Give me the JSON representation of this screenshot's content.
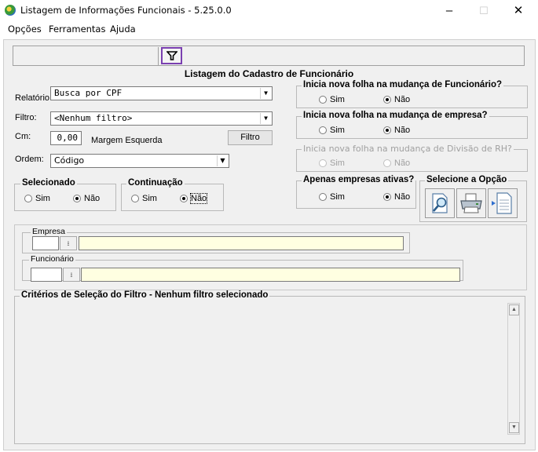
{
  "window": {
    "title": "Listagem de Informações Funcionais - 5.25.0.0",
    "minimize": "–",
    "maximize": "☐",
    "close": "✕"
  },
  "menu": [
    "Opções",
    "Ferramentas",
    "Ajuda"
  ],
  "heading": "Listagem do Cadastro de Funcionário",
  "form": {
    "relatorio_label": "Relatório",
    "relatorio_value": "Busca por CPF",
    "filtro_label": "Filtro:",
    "filtro_value": "<Nenhum filtro>",
    "cm_label": "Cm:",
    "cm_value": "0,00",
    "margem_label": "Margem Esquerda",
    "filtro_button": "Filtro",
    "ordem_label": "Ordem:",
    "ordem_value": "Código"
  },
  "groups": {
    "selecionado": {
      "title": "Selecionado",
      "sim": "Sim",
      "nao": "Não",
      "selected": "nao"
    },
    "continuacao": {
      "title": "Continuação",
      "sim": "Sim",
      "nao": "Não",
      "selected": "nao"
    },
    "nova_folha_funcionario": {
      "title": "Inicia nova folha na mudança de Funcionário?",
      "sim": "Sim",
      "nao": "Não",
      "selected": "nao"
    },
    "nova_folha_empresa": {
      "title": "Inicia nova folha na mudança de empresa?",
      "sim": "Sim",
      "nao": "Não",
      "selected": "nao"
    },
    "nova_folha_divisao": {
      "title": "Inicia nova folha na mudança de Divisão de RH?",
      "sim": "Sim",
      "nao": "Não",
      "selected": "none",
      "disabled": true
    },
    "empresas_ativas": {
      "title": "Apenas empresas ativas?",
      "sim": "Sim",
      "nao": "Não",
      "selected": "nao"
    },
    "selecione_opcao": {
      "title": "Selecione a Opção"
    }
  },
  "action_icons": [
    "preview-icon",
    "printer-icon",
    "export-file-icon"
  ],
  "empresa": {
    "label": "Empresa",
    "code": "",
    "name": ""
  },
  "funcionario": {
    "label": "Funcionário",
    "code": "",
    "name": ""
  },
  "criteria": {
    "title": "Critérios de Seleção do Filtro - Nenhum filtro selecionado",
    "text": ""
  },
  "colors": {
    "accent_filter_border": "#7a3fb0",
    "lookup_fill": "#ffffe1",
    "panel_bg": "#f0f0f0"
  }
}
